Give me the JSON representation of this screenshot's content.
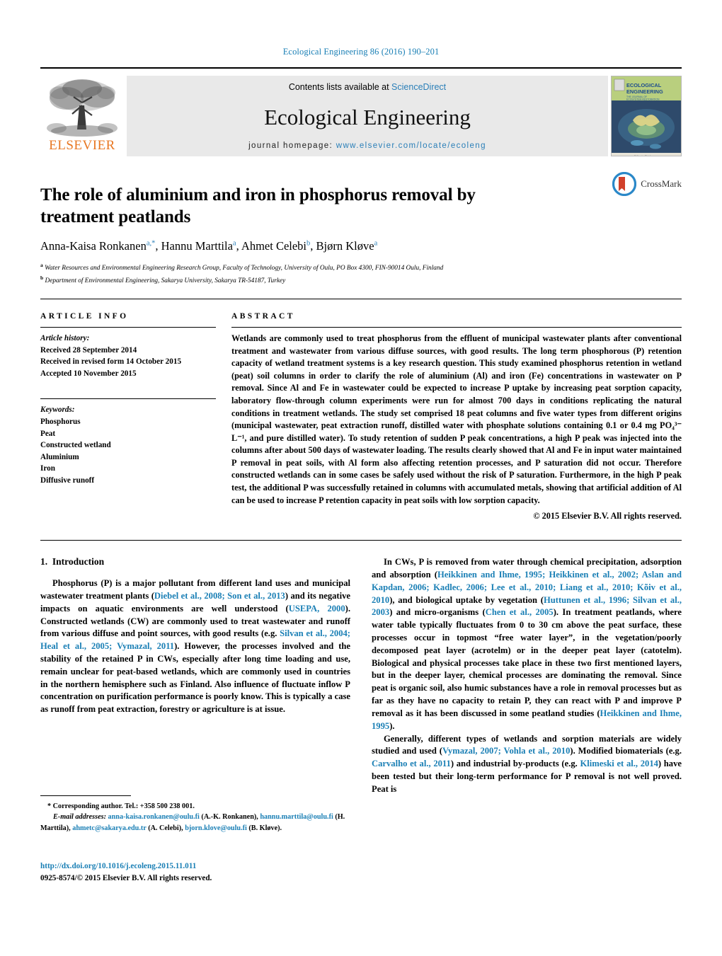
{
  "running_head": "Ecological Engineering 86 (2016) 190–201",
  "masthead": {
    "contents_prefix": "Contents lists available at ",
    "sciencedirect": "ScienceDirect",
    "journal_name": "Ecological Engineering",
    "homepage_prefix": "journal homepage: ",
    "homepage_url": "www.elsevier.com/locate/ecoleng",
    "publisher": "ELSEVIER",
    "cover": {
      "line1": "ECOLOGICAL",
      "line2": "ENGINEERING",
      "subtitle": "THE JOURNAL OF\nECOSYSTEM RESTORATION",
      "footer1": "Editor-in-Chief",
      "footer2": "William J. Mitsch"
    }
  },
  "crossmark": {
    "label": "CrossMark"
  },
  "article": {
    "title": "The role of aluminium and iron in phosphorus removal by treatment peatlands",
    "authors_html": "Anna-Kaisa Ronkanen<sup>a,*</sup>, Hannu Marttila<sup>a</sup>, Ahmet Celebi<sup>b</sup>, Bjørn Kløve<sup>a</sup>",
    "affiliation_a": "Water Resources and Environmental Engineering Research Group, Faculty of Technology, University of Oulu, PO Box 4300, FIN-90014 Oulu, Finland",
    "affiliation_b": "Department of Environmental Engineering, Sakarya University, Sakarya TR-54187, Turkey"
  },
  "article_info": {
    "heading": "ARTICLE INFO",
    "history_label": "Article history:",
    "history": [
      "Received 28 September 2014",
      "Received in revised form 14 October 2015",
      "Accepted 10 November 2015"
    ],
    "keywords_label": "Keywords:",
    "keywords": [
      "Phosphorus",
      "Peat",
      "Constructed wetland",
      "Aluminium",
      "Iron",
      "Diffusive runoff"
    ]
  },
  "abstract": {
    "heading": "ABSTRACT",
    "text": "Wetlands are commonly used to treat phosphorus from the effluent of municipal wastewater plants after conventional treatment and wastewater from various diffuse sources, with good results. The long term phosphorous (P) retention capacity of wetland treatment systems is a key research question. This study examined phosphorus retention in wetland (peat) soil columns in order to clarify the role of aluminium (Al) and iron (Fe) concentrations in wastewater on P removal. Since Al and Fe in wastewater could be expected to increase P uptake by increasing peat sorption capacity, laboratory flow-through column experiments were run for almost 700 days in conditions replicating the natural conditions in treatment wetlands. The study set comprised 18 peat columns and five water types from different origins (municipal wastewater, peat extraction runoff, distilled water with phosphate solutions containing 0.1 or 0.4 mg PO₄³⁻ L⁻¹, and pure distilled water). To study retention of sudden P peak concentrations, a high P peak was injected into the columns after about 500 days of wastewater loading. The results clearly showed that Al and Fe in input water maintained P removal in peat soils, with Al form also affecting retention processes, and P saturation did not occur. Therefore constructed wetlands can in some cases be safely used without the risk of P saturation. Furthermore, in the high P peak test, the additional P was successfully retained in columns with accumulated metals, showing that artificial addition of Al can be used to increase P retention capacity in peat soils with low sorption capacity.",
    "copyright": "© 2015 Elsevier B.V. All rights reserved."
  },
  "introduction": {
    "section_number": "1.",
    "section_title": "Introduction",
    "left_paragraph_html": "Phosphorus (P) is a major pollutant from different land uses and municipal wastewater treatment plants (<a class=\"cite\" href=\"#\">Diebel et al., 2008; Son et al., 2013</a>) and its negative impacts on aquatic environments are well understood (<a class=\"cite\" href=\"#\">USEPA, 2000</a>). Constructed wetlands (CW) are commonly used to treat wastewater and runoff from various diffuse and point sources, with good results (e.g. <a class=\"cite\" href=\"#\">Silvan et al., 2004; Heal et al., 2005; Vymazal, 2011</a>). However, the processes involved and the stability of the retained P in CWs, especially after long time loading and use, remain unclear for peat-based wetlands, which are commonly used in countries in the northern hemisphere such as Finland. Also influence of fluctuate inflow P concentration on purification performance is poorly know. This is typically a case as runoff from peat extraction, forestry or agriculture is at issue.",
    "right_paragraph_1_html": "In CWs, P is removed from water through chemical precipitation, adsorption and absorption (<a class=\"cite\" href=\"#\">Heikkinen and Ihme, 1995; Heikkinen et al., 2002; Aslan and Kapdan, 2006; Kadlec, 2006; Lee et al., 2010; Liang et al., 2010; Kõiv et al., 2010</a>), and biological uptake by vegetation (<a class=\"cite\" href=\"#\">Huttunen et al., 1996; Silvan et al., 2003</a>) and micro-organisms (<a class=\"cite\" href=\"#\">Chen et al., 2005</a>). In treatment peatlands, where water table typically fluctuates from 0 to 30 cm above the peat surface, these processes occur in topmost “free water layer”, in the vegetation/poorly decomposed peat layer (acrotelm) or in the deeper peat layer (catotelm). Biological and physical processes take place in these two first mentioned layers, but in the deeper layer, chemical processes are dominating the removal. Since peat is organic soil, also humic substances have a role in removal processes but as far as they have no capacity to retain P, they can react with P and improve P removal as it has been discussed in some peatland studies (<a class=\"cite\" href=\"#\">Heikkinen and Ihme, 1995</a>).",
    "right_paragraph_2_html": "Generally, different types of wetlands and sorption materials are widely studied and used (<a class=\"cite\" href=\"#\">Vymazal, 2007; Vohla et al., 2010</a>). Modified biomaterials (e.g. <a class=\"cite\" href=\"#\">Carvalho et al., 2011</a>) and industrial by-products (e.g. <a class=\"cite\" href=\"#\">Klimeski et al., 2014</a>) have been tested but their long-term performance for P removal is not well proved. Peat is"
  },
  "footnotes": {
    "corresponding_html": "* Corresponding author. Tel.: +358 500 238 001.",
    "emails_html": "<span class=\"ital\">E-mail addresses:</span> <a href=\"#\">anna-kaisa.ronkanen@oulu.fi</a> (A.-K. Ronkanen), <a href=\"#\">hannu.marttila@oulu.fi</a> (H. Marttila), <a href=\"#\">ahmetc@sakarya.edu.tr</a> (A. Celebi), <a href=\"#\">bjorn.klove@oulu.fi</a> (B. Kløve)."
  },
  "doi_block": {
    "doi_url": "http://dx.doi.org/10.1016/j.ecoleng.2015.11.011",
    "issn_line": "0925-8574/© 2015 Elsevier B.V. All rights reserved."
  },
  "colors": {
    "link_blue": "#1a7fb5",
    "elsevier_orange": "#e87722",
    "band_gray": "#e9e9e9"
  }
}
